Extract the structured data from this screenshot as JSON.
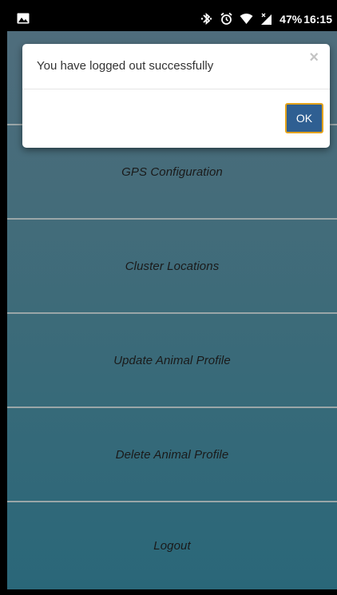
{
  "status_bar": {
    "battery_percent": "47%",
    "time": "16:15",
    "icons": [
      "image-icon",
      "bluetooth-icon",
      "alarm-icon",
      "wifi-icon",
      "signal-icon"
    ]
  },
  "dialog": {
    "message": "You have logged out successfully",
    "close_label": "×",
    "ok_label": "OK"
  },
  "menu": {
    "items": [
      {
        "label": ""
      },
      {
        "label": "GPS Configuration"
      },
      {
        "label": "Cluster Locations"
      },
      {
        "label": "Update Animal Profile"
      },
      {
        "label": "Delete Animal Profile"
      },
      {
        "label": "Logout"
      }
    ]
  },
  "colors": {
    "ok_button": "#2f5f92",
    "ok_border": "#e3a21a",
    "screen_top": "#4f6d7c",
    "screen_bottom": "#2a6779"
  }
}
